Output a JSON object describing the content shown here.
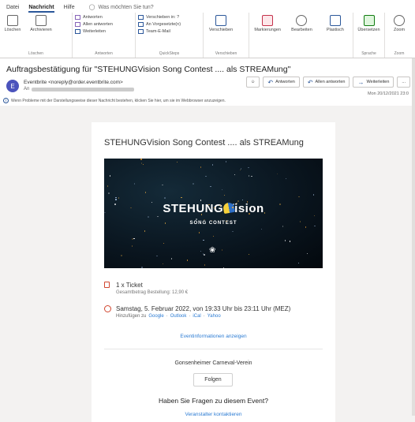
{
  "tabs": [
    "Datei",
    "Nachricht",
    "Hilfe"
  ],
  "active_tab": "Nachricht",
  "tell_me": "Was möchten Sie tun?",
  "ribbon": {
    "groups": [
      {
        "label": "Löschen",
        "buttons": [
          "Löschen",
          "Archivieren"
        ]
      },
      {
        "label": "Antworten",
        "items": [
          "Antworten",
          "Allen antworten",
          "Weiterleiten"
        ]
      },
      {
        "label": "QuickSteps",
        "items": [
          "Verschieben in: ?",
          "An Vorgesetzte(n)",
          "Team-E-Mail"
        ]
      },
      {
        "label": "Verschieben",
        "buttons": [
          "Verschieben"
        ]
      },
      {
        "label": "",
        "buttons": [
          "Markierungen",
          "Bearbeiten",
          "Plastisch"
        ]
      },
      {
        "label": "Sprache",
        "buttons": [
          "Übersetzen"
        ]
      },
      {
        "label": "Zoom",
        "buttons": [
          "Zoom"
        ]
      }
    ]
  },
  "email": {
    "subject": "Auftragsbestätigung für \"STEHUNGVision Song Contest .... als STREAMung\"",
    "avatar": "E",
    "from": "Eventbrite <noreply@order.eventbrite.com>",
    "to_label": "An",
    "date": "Mon 20/12/2021 23:0",
    "info": "Wenn Probleme mit der Darstellungsweise dieser Nachricht bestehen, klicken Sie hier, um sie im Webbrowser anzuzeigen.",
    "actions": [
      "Antworten",
      "Allen antworten",
      "Weiterleiten",
      "..."
    ]
  },
  "card": {
    "title": "STEHUNGVision Song Contest .... als STREAMung",
    "banner_logo_a": "STEHUNG",
    "banner_logo_b": "ision",
    "banner_sub": "SONG CONTEST",
    "ticket": "1 x Ticket",
    "total": "Gesamtbetrag Bestellung: 12,90 €",
    "when": "Samstag, 5. Februar 2022, von 19:33 Uhr bis 23:11 Uhr (MEZ)",
    "add_to": "Hinzufügen zu",
    "calendars": [
      "Google",
      "Outlook",
      "iCal",
      "Yahoo"
    ],
    "event_info": "Eventinformationen anzeigen",
    "organizer": "Gonsenheimer Carneval-Verein",
    "follow": "Folgen",
    "question": "Haben Sie Fragen zu diesem Event?",
    "contact": "Veranstalter kontaktieren"
  }
}
